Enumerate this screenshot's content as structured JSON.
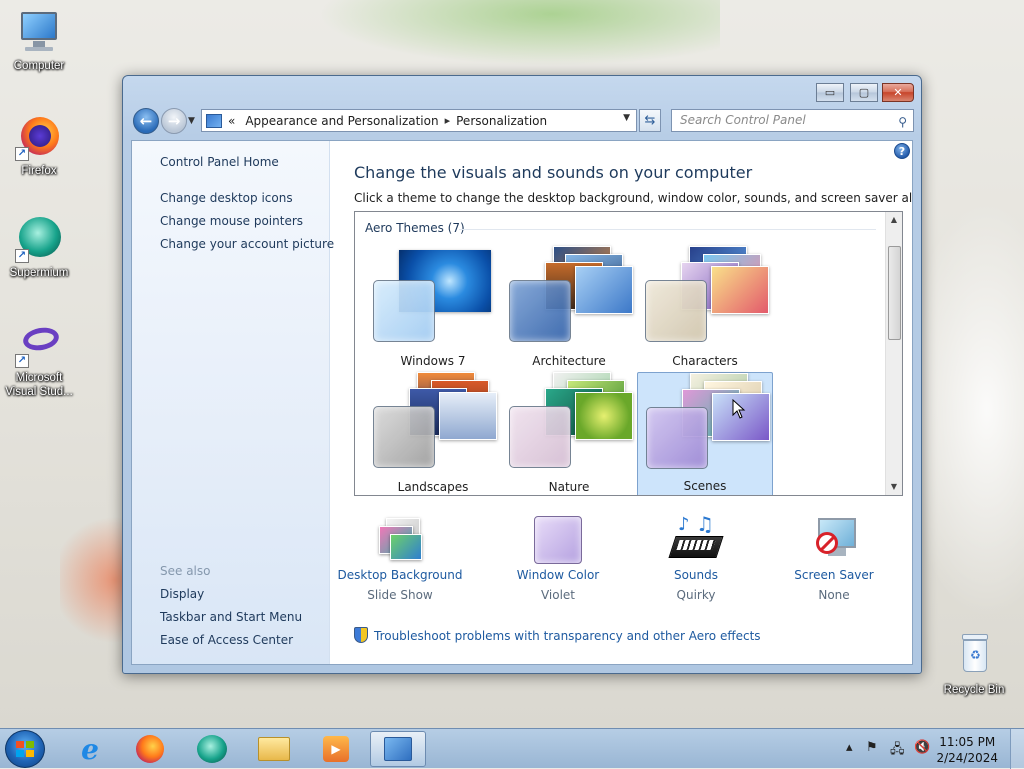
{
  "desktop": {
    "icons": [
      {
        "label": "Computer"
      },
      {
        "label": "Firefox"
      },
      {
        "label": "Supermium"
      },
      {
        "label": "Microsoft Visual Stud..."
      },
      {
        "label": "Recycle Bin"
      }
    ]
  },
  "window": {
    "buttons": {
      "minimize": "▭",
      "maximize": "▢",
      "close": "✕"
    },
    "breadcrumb": {
      "prefix": "«",
      "items": [
        "Appearance and Personalization",
        "Personalization"
      ],
      "separator": "▸"
    },
    "search_placeholder": "Search Control Panel",
    "left_nav": {
      "home": "Control Panel Home",
      "tasks": [
        "Change desktop icons",
        "Change mouse pointers",
        "Change your account picture"
      ],
      "see_also_label": "See also",
      "see_also": [
        "Display",
        "Taskbar and Start Menu",
        "Ease of Access Center"
      ]
    },
    "main": {
      "title": "Change the visuals and sounds on your computer",
      "subtitle": "Click a theme to change the desktop background, window color, sounds, and screen saver all at once.",
      "group_label": "Aero Themes (7)",
      "themes": [
        {
          "name": "Windows 7",
          "selected": false
        },
        {
          "name": "Architecture",
          "selected": false
        },
        {
          "name": "Characters",
          "selected": false
        },
        {
          "name": "Landscapes",
          "selected": false
        },
        {
          "name": "Nature",
          "selected": false
        },
        {
          "name": "Scenes",
          "selected": true
        }
      ],
      "settings": [
        {
          "name": "Desktop Background",
          "value": "Slide Show",
          "icon": "desktop-background-icon"
        },
        {
          "name": "Window Color",
          "value": "Violet",
          "icon": "window-color-icon"
        },
        {
          "name": "Sounds",
          "value": "Quirky",
          "icon": "sounds-icon"
        },
        {
          "name": "Screen Saver",
          "value": "None",
          "icon": "screen-saver-icon"
        }
      ],
      "troubleshoot_link": "Troubleshoot problems with transparency and other Aero effects"
    }
  },
  "taskbar": {
    "apps": [
      "Internet Explorer",
      "Firefox",
      "Supermium",
      "Windows Explorer",
      "Windows Media Player",
      "Control Panel"
    ],
    "clock_time": "11:05 PM",
    "clock_date": "2/24/2024"
  },
  "colors": {
    "accent": "#1e5aa0",
    "selected_theme_bg": "#cde4fb",
    "window_frame": "#b7cde6"
  }
}
